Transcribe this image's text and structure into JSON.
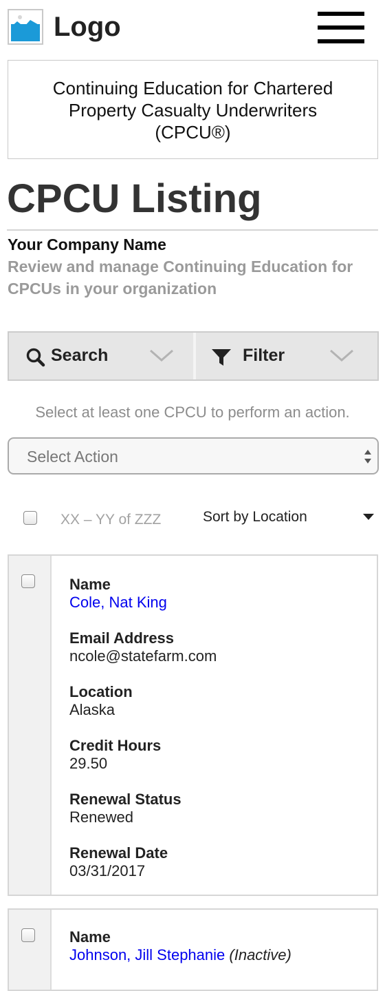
{
  "header": {
    "logo_text": "Logo",
    "logo_icon": "image-placeholder-icon",
    "menu_icon": "hamburger-menu-icon"
  },
  "banner": {
    "lines": [
      "Continuing Education for Chartered",
      "Property Casualty Underwriters",
      "(CPCU®)"
    ]
  },
  "page": {
    "title": "CPCU Listing",
    "company": "Your Company Name",
    "subtitle": "Review and manage Continuing Education for CPCUs in your organization"
  },
  "toolbar": {
    "search_label": "Search",
    "filter_label": "Filter"
  },
  "actions": {
    "helper_text": "Select at least one CPCU to perform an action.",
    "select_placeholder": "Select Action"
  },
  "list": {
    "range_text": "XX – YY of ZZZ",
    "sort_label": "Sort by Location"
  },
  "cards": [
    {
      "name_label": "Name",
      "name": "Cole, Nat King",
      "email_label": "Email Address",
      "email": "ncole@statefarm.com",
      "location_label": "Location",
      "location": "Alaska",
      "credit_label": "Credit Hours",
      "credit": "29.50",
      "status_label": "Renewal Status",
      "status": "Renewed",
      "date_label": "Renewal Date",
      "date": "03/31/2017"
    },
    {
      "name_label": "Name",
      "name": "Johnson, Jill Stephanie",
      "name_suffix": "(Inactive)"
    }
  ],
  "colors": {
    "link": "#0000ee",
    "muted_text": "#9a9a9a",
    "toolbar_bg": "#e6e6e6",
    "logo_blue": "#1b9ad8"
  }
}
